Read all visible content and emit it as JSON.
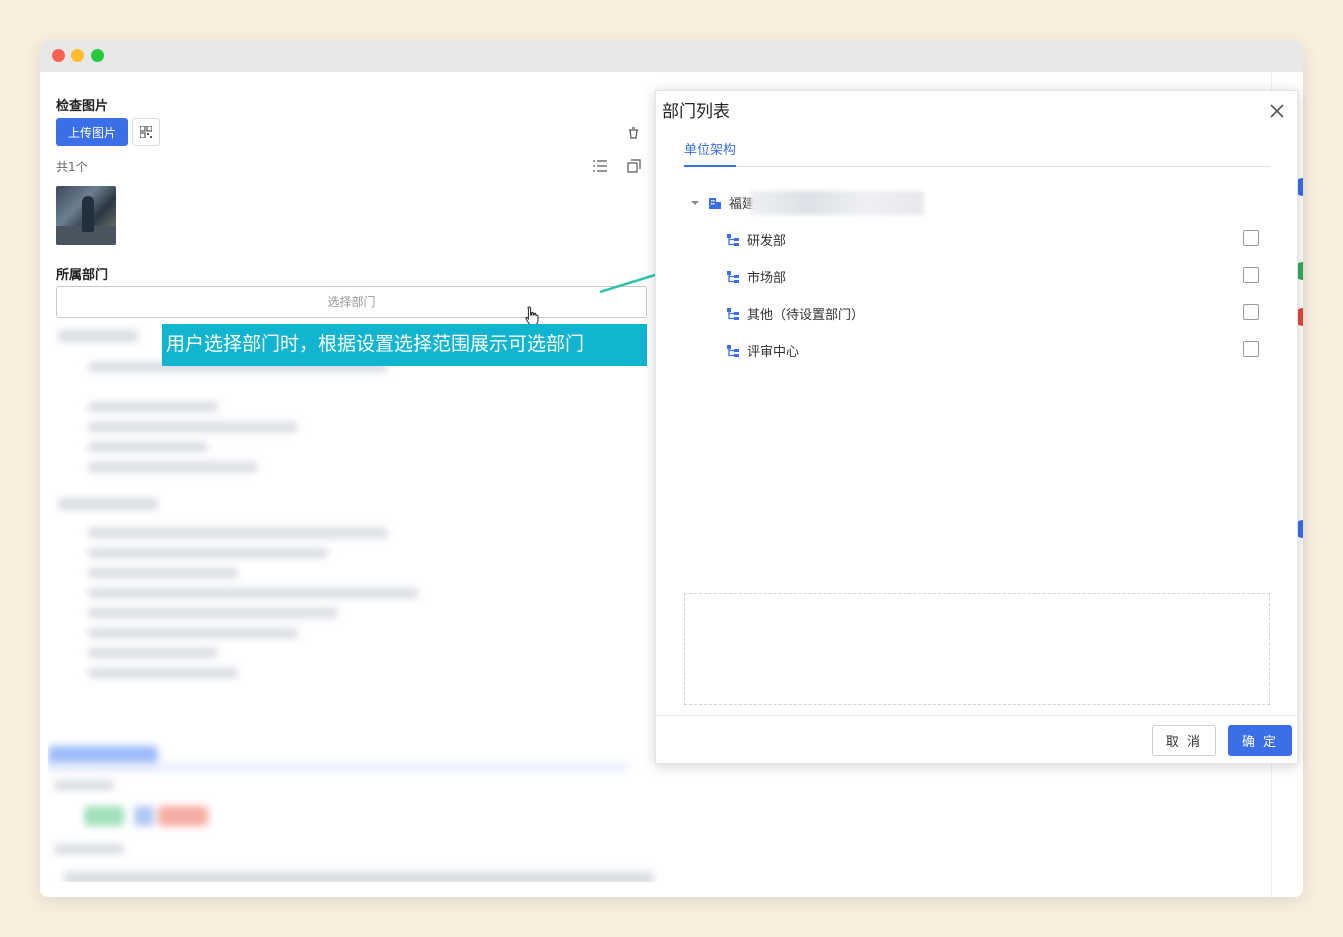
{
  "form": {
    "inspection_image_label": "检查图片",
    "upload_button": "上传图片",
    "image_count": "共1个",
    "department_label": "所属部门",
    "department_placeholder": "选择部门"
  },
  "annotation": {
    "callout_text": "用户选择部门时，根据设置选择范围展示可选部门",
    "callout_color": "#12b5cf",
    "arrow_color": "#2ec4b0"
  },
  "dialog": {
    "title": "部门列表",
    "tab_label": "单位架构",
    "root_label": "福建",
    "departments": [
      {
        "label": "研发部",
        "checked": false
      },
      {
        "label": "市场部",
        "checked": false
      },
      {
        "label": "其他（待设置部门）",
        "checked": false
      },
      {
        "label": "评审中心",
        "checked": false
      }
    ],
    "cancel_button": "取 消",
    "confirm_button": "确 定"
  },
  "colors": {
    "primary": "#3a6fe8",
    "background": "#f8efdf"
  }
}
